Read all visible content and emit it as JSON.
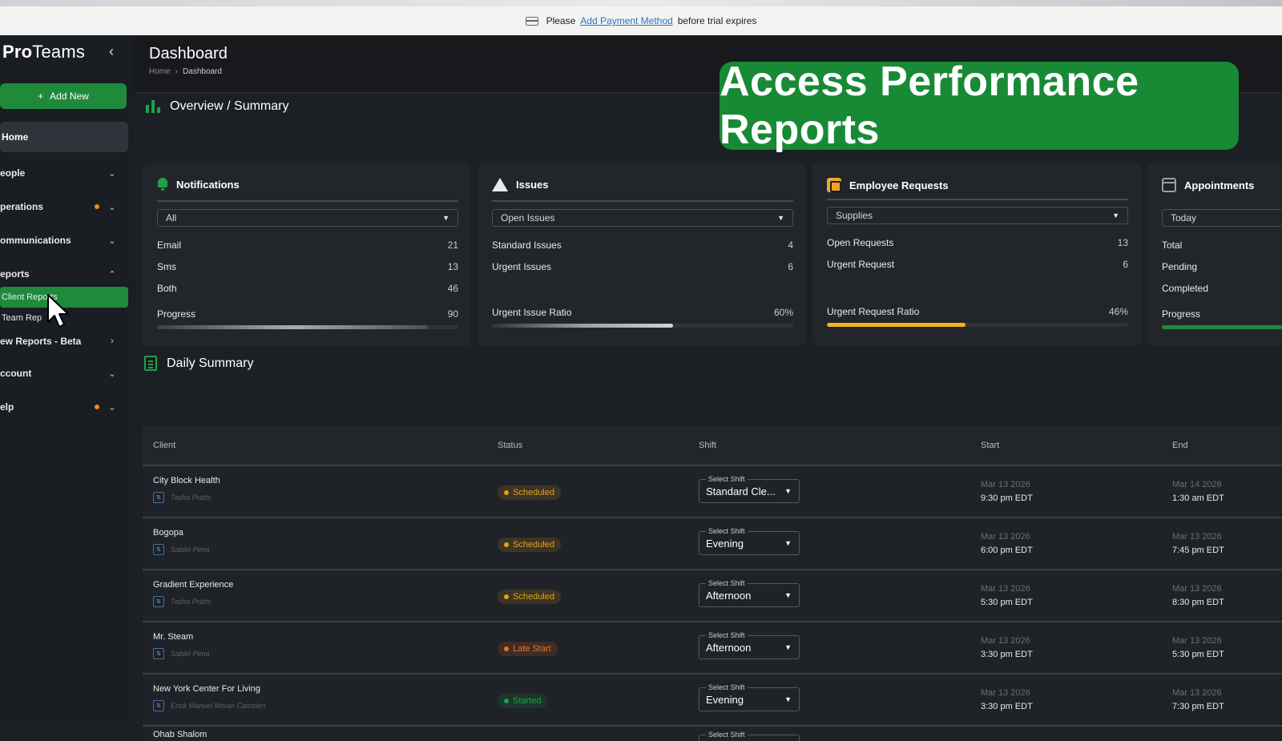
{
  "trial_banner": {
    "prefix": "Please",
    "link": "Add Payment Method",
    "suffix": "before trial expires"
  },
  "sidebar": {
    "brand_bold": "Pro",
    "brand_rest": "Teams",
    "add_new": "Add New",
    "home": "Home",
    "items": [
      {
        "label": "eople"
      },
      {
        "label": "perations"
      },
      {
        "label": "ommunications"
      },
      {
        "label": "eports"
      },
      {
        "label": "ew Reports - Beta"
      },
      {
        "label": "ccount"
      },
      {
        "label": "elp"
      }
    ],
    "subitems": [
      {
        "label": "Client Reports"
      },
      {
        "label": "Team Rep"
      }
    ]
  },
  "header": {
    "title": "Dashboard",
    "crumb_home": "Home",
    "crumb_current": "Dashboard"
  },
  "overlay_banner": "Access Performance Reports",
  "overview": {
    "title": "Overview / Summary",
    "cards": [
      {
        "title": "Notifications",
        "filter": "All",
        "rows": [
          {
            "label": "Email",
            "value": "21"
          },
          {
            "label": "Sms",
            "value": "13"
          },
          {
            "label": "Both",
            "value": "46"
          }
        ],
        "progress_label": "Progress",
        "progress_value": "90",
        "progress_fraction": 0.9
      },
      {
        "title": "Issues",
        "filter": "Open Issues",
        "rows": [
          {
            "label": "Standard Issues",
            "value": "4"
          },
          {
            "label": "Urgent Issues",
            "value": "6"
          }
        ],
        "progress_label": "Urgent Issue Ratio",
        "progress_value": "60%",
        "progress_fraction": 0.6
      },
      {
        "title": "Employee Requests",
        "filter": "Supplies",
        "rows": [
          {
            "label": "Open Requests",
            "value": "13"
          },
          {
            "label": "Urgent Request",
            "value": "6"
          }
        ],
        "progress_label": "Urgent Request Ratio",
        "progress_value": "46%",
        "progress_fraction": 0.46
      },
      {
        "title": "Appointments",
        "filter": "Today",
        "rows": [
          {
            "label": "Total",
            "value": ""
          },
          {
            "label": "Pending",
            "value": ""
          },
          {
            "label": "Completed",
            "value": ""
          }
        ],
        "progress_label": "Progress",
        "progress_value": ""
      }
    ]
  },
  "daily": {
    "title": "Daily Summary",
    "columns": {
      "client": "Client",
      "status": "Status",
      "shift": "Shift",
      "start": "Start",
      "end": "End"
    },
    "shift_caption": "Select Shift",
    "rows": [
      {
        "client": "City Block Health",
        "assignee": "Tasha Pratts",
        "status": "Scheduled",
        "shift": "Standard Cle...",
        "start_date": "Mar 13 2026",
        "start_time": "9:30 pm EDT",
        "end_date": "Mar 14 2026",
        "end_time": "1:30 am EDT"
      },
      {
        "client": "Bogopa",
        "assignee": "Sabiel Pena",
        "status": "Scheduled",
        "shift": "Evening",
        "start_date": "Mar 13 2026",
        "start_time": "6:00 pm EDT",
        "end_date": "Mar 13 2026",
        "end_time": "7:45 pm EDT"
      },
      {
        "client": "Gradient Experience",
        "assignee": "Tasha Pratts",
        "status": "Scheduled",
        "shift": "Afternoon",
        "start_date": "Mar 13 2026",
        "start_time": "5:30 pm EDT",
        "end_date": "Mar 13 2026",
        "end_time": "8:30 pm EDT"
      },
      {
        "client": "Mr. Steam",
        "assignee": "Sabiel Pena",
        "status": "Late Start",
        "shift": "Afternoon",
        "start_date": "Mar 13 2026",
        "start_time": "3:30 pm EDT",
        "end_date": "Mar 13 2026",
        "end_time": "5:30 pm EDT"
      },
      {
        "client": "New York Center For Living",
        "assignee": "Erick Manuel Moran Carcelen",
        "status": "Started",
        "shift": "Evening",
        "start_date": "Mar 13 2026",
        "start_time": "3:30 pm EDT",
        "end_date": "Mar 13 2026",
        "end_time": "7:30 pm EDT"
      },
      {
        "client": "Ohab Shalom",
        "assignee": "",
        "status": "",
        "shift": "",
        "start_date": "",
        "start_time": "",
        "end_date": "",
        "end_time": ""
      }
    ]
  },
  "colors": {
    "accent_green": "#1f8a3b",
    "banner_green": "#188a36",
    "notif_dot": "#f28a1c",
    "scheduled": "#e3a21a",
    "late_start": "#f0741f",
    "started": "#1fa14a",
    "request_bar": "#f2b21b"
  },
  "icons": [
    "chevron-left-icon",
    "plus-icon",
    "chevron-down-icon",
    "chevron-up-icon",
    "chevron-right-icon",
    "bar-chart-icon",
    "bell-icon",
    "warning-icon",
    "box-icon",
    "calendar-icon",
    "clipboard-icon",
    "credit-card-icon",
    "cursor-arrow-icon"
  ]
}
